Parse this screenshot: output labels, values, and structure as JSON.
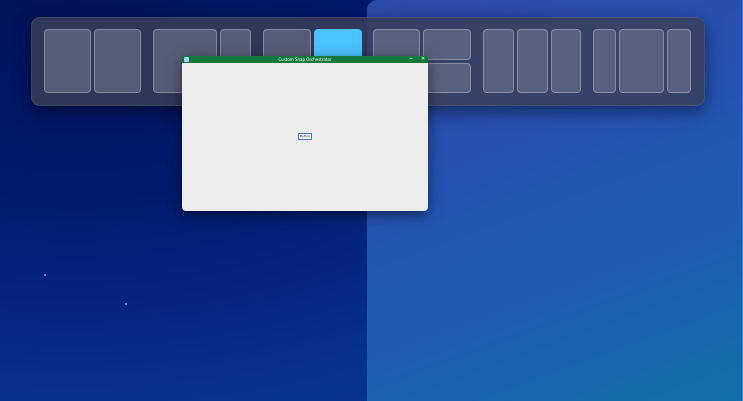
{
  "window": {
    "title": "Custom Snap Orchestrator",
    "minimize_glyph": "−",
    "close_glyph": "✕",
    "button_label": "Button",
    "titlebar_color": "#137a3b"
  },
  "snap_layouts": {
    "active_zone_color": "#4cc2ff",
    "layouts": [
      {
        "name": "two-halves"
      },
      {
        "name": "wide-left-narrow-right"
      },
      {
        "name": "three-columns-middle-active"
      },
      {
        "name": "left-half-right-stacked"
      },
      {
        "name": "three-equal-columns"
      },
      {
        "name": "narrow-wide-narrow"
      }
    ]
  },
  "icons": [
    "app-icon",
    "minimize-icon",
    "close-icon"
  ]
}
